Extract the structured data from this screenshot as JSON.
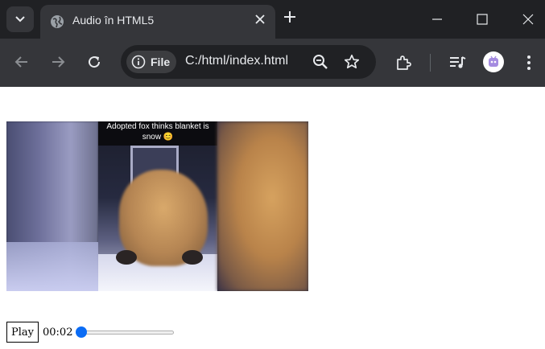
{
  "tabstrip": {
    "tab_title": "Audio în HTML5"
  },
  "toolbar": {
    "site_chip_label": "File",
    "url": "C:/html/index.html"
  },
  "page": {
    "video_caption": "Adopted fox thinks blanket is snow 😊",
    "player": {
      "play_label": "Play",
      "time": "00:02",
      "progress_fraction": 0.0
    }
  },
  "colors": {
    "tabstrip_bg": "#202124",
    "toolbar_bg": "#35363a",
    "slider_accent": "#0b6cf5"
  },
  "icons": {
    "tab_search": "chevron-down-icon",
    "favicon": "globe-icon",
    "tab_close": "close-icon",
    "new_tab": "plus-icon",
    "minimize": "minimize-icon",
    "maximize": "maximize-icon",
    "close_window": "close-icon",
    "back": "back-arrow-icon",
    "forward": "forward-arrow-icon",
    "reload": "reload-icon",
    "site_info": "info-icon",
    "zoom": "zoom-out-icon",
    "bookmark": "star-icon",
    "extensions": "puzzle-icon",
    "media": "media-queue-icon",
    "menu": "kebab-menu-icon"
  }
}
